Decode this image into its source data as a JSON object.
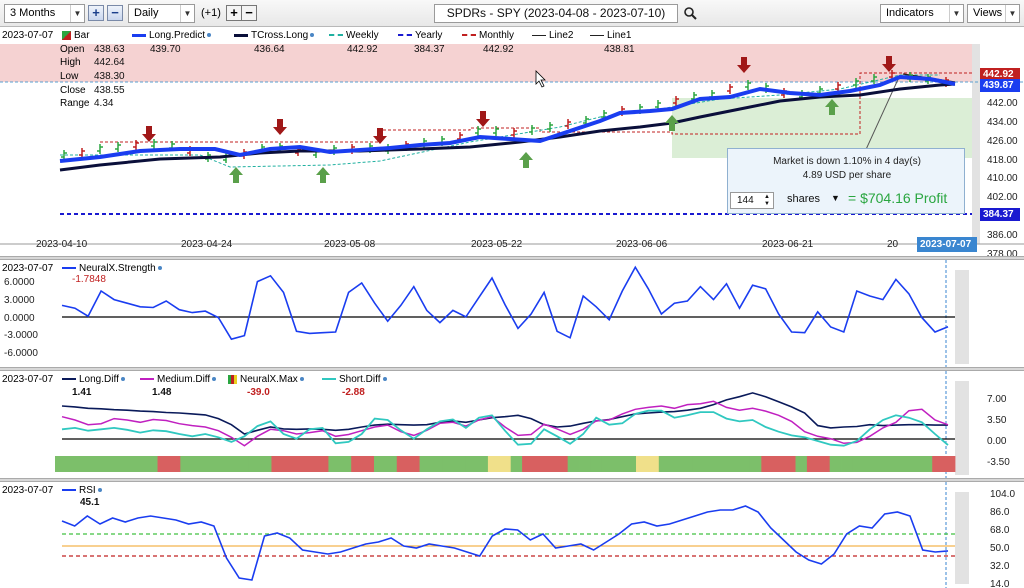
{
  "toolbar": {
    "range": "3 Months",
    "interval": "Daily",
    "offset": "(+1)",
    "title": "SPDRs - SPY (2023-04-08 - 2023-07-10)",
    "indicators": "Indicators",
    "views": "Views",
    "plus": "+",
    "minus": "−"
  },
  "main": {
    "date": "2023-07-07",
    "ohlc": {
      "open_label": "Open",
      "open": "438.63",
      "high_label": "High",
      "high": "442.64",
      "low_label": "Low",
      "low": "438.30",
      "close_label": "Close",
      "close": "438.55",
      "range_label": "Range",
      "range": "4.34"
    },
    "legend": {
      "bar": "Bar",
      "long_predict": "Long.Predict",
      "long_predict_val": "439.70",
      "tcross_long": "TCross.Long",
      "tcross_long_val": "436.64",
      "weekly": "Weekly",
      "weekly_val": "442.92",
      "yearly": "Yearly",
      "yearly_val": "384.37",
      "monthly": "Monthly",
      "monthly_val": "442.92",
      "line2": "Line2",
      "line1": "Line1",
      "line1_val": "438.81"
    },
    "y_ticks": [
      "450.00",
      "442.00",
      "434.00",
      "426.00",
      "418.00",
      "410.00",
      "402.00",
      "394.00",
      "386.00",
      "378.00"
    ],
    "x_ticks": [
      "2023-04-10",
      "2023-04-24",
      "2023-05-08",
      "2023-05-22",
      "2023-06-06",
      "2023-06-21",
      "20"
    ],
    "price_boxes": {
      "top": "442.92",
      "current": "439.87",
      "yearly": "384.37"
    },
    "cursor_date": "2023-07-07",
    "popup": {
      "line1": "Market is down 1.10% in 4 day(s)",
      "line2": "4.89 USD per share",
      "shares": "144",
      "shares_label": "shares",
      "profit": "= $704.16 Profit"
    }
  },
  "strength": {
    "date": "2023-07-07",
    "name": "NeuralX.Strength",
    "value": "-1.7848",
    "y_ticks": [
      "6.0000",
      "3.0000",
      "0.0000",
      "-3.0000",
      "-6.0000"
    ],
    "series": [
      1.2,
      0.8,
      -0.3,
      3.2,
      2.0,
      1.5,
      1.0,
      0.9,
      1.8,
      0.6,
      0.2,
      0.4,
      -0.5,
      -3.5,
      -3.0,
      4.5,
      5.3,
      3.0,
      -2.4,
      -2.7,
      -2.6,
      -2.5,
      3.0,
      4.3,
      1.5,
      -1.0,
      1.2,
      3.8,
      0.5,
      -1.2,
      0.5,
      -0.4,
      2.3,
      5.0,
      1.3,
      -2.0,
      0.0,
      3.0,
      -2.4,
      -3.3,
      2.5,
      1.0,
      -0.8,
      3.2,
      6.5,
      3.5,
      0.0,
      1.5,
      1.8,
      3.8,
      2.0,
      4.2,
      0.8,
      4.0,
      3.5,
      0.0,
      -2.5,
      -2.6,
      0.3,
      -1.8,
      -2.5,
      3.2,
      2.5,
      2.0,
      4.8,
      2.8,
      -0.5,
      -2.5,
      -1.78
    ]
  },
  "diffs": {
    "date": "2023-07-07",
    "long_name": "Long.Diff",
    "long_val": "1.41",
    "medium_name": "Medium.Diff",
    "medium_val": "1.48",
    "max_name": "NeuralX.Max",
    "max_val": "-39.0",
    "short_name": "Short.Diff",
    "short_val": "-2.88",
    "y_ticks": [
      "7.00",
      "3.50",
      "0.00",
      "-3.50"
    ],
    "long_series": [
      5.5,
      5.3,
      5.0,
      4.9,
      4.7,
      4.6,
      4.4,
      4.3,
      4.1,
      4.0,
      3.8,
      3.6,
      2.8,
      1.5,
      -0.5,
      0.3,
      1.0,
      0.6,
      0.5,
      0.6,
      0.5,
      0.3,
      0.5,
      1.0,
      1.4,
      1.6,
      1.5,
      1.4,
      1.5,
      2.0,
      2.3,
      2.0,
      2.5,
      3.0,
      3.2,
      3.5,
      2.8,
      1.5,
      1.0,
      1.2,
      1.8,
      2.3,
      2.6,
      3.2,
      3.8,
      4.0,
      4.2,
      4.3,
      4.6,
      5.0,
      5.8,
      6.8,
      7.5,
      8.3,
      7.5,
      6.4,
      5.3,
      4.0,
      1.3,
      0.8,
      1.0,
      1.1,
      1.5,
      1.3,
      1.4,
      1.5,
      1.5,
      1.4,
      1.41
    ],
    "medium_series": [
      3.2,
      2.5,
      1.5,
      1.7,
      2.8,
      2.5,
      2.0,
      2.6,
      2.4,
      1.7,
      1.3,
      1.0,
      0.2,
      -1.2,
      -3.0,
      -1.0,
      0.5,
      0.2,
      -0.5,
      -0.2,
      0.2,
      -1.0,
      -0.6,
      0.2,
      1.0,
      1.4,
      0.0,
      -0.8,
      0.3,
      1.8,
      2.0,
      1.2,
      2.5,
      3.2,
      1.0,
      -0.8,
      -0.6,
      1.6,
      0.6,
      -0.6,
      0.5,
      2.3,
      2.5,
      3.8,
      4.8,
      5.2,
      5.5,
      5.0,
      5.8,
      6.0,
      6.5,
      5.2,
      4.6,
      5.0,
      4.4,
      3.5,
      2.2,
      0.0,
      -1.0,
      -1.5,
      -2.5,
      -2.3,
      -1.0,
      0.8,
      2.0,
      4.5,
      4.8,
      2.5,
      1.48
    ],
    "short_series": [
      0.5,
      0.8,
      0.2,
      0.5,
      0.8,
      0.4,
      -0.2,
      0.3,
      0.1,
      -0.5,
      -1.0,
      -0.5,
      -1.2,
      -2.2,
      -1.0,
      1.2,
      2.2,
      -0.5,
      -1.5,
      0.5,
      0.8,
      -2.5,
      -2.2,
      -0.5,
      2.8,
      2.5,
      0.3,
      -1.5,
      0.5,
      2.2,
      2.6,
      0.8,
      3.0,
      3.5,
      0.2,
      -2.8,
      -2.6,
      0.5,
      -1.0,
      -2.6,
      -0.5,
      3.0,
      1.5,
      1.8,
      3.8,
      4.5,
      4.5,
      3.0,
      3.5,
      4.2,
      4.2,
      2.8,
      2.2,
      2.5,
      1.0,
      0.0,
      -0.8,
      -1.2,
      -2.0,
      -2.8,
      -3.0,
      -2.0,
      0.5,
      2.5,
      3.5,
      3.0,
      2.0,
      -0.5,
      -2.88
    ],
    "band": [
      "G",
      "G",
      "G",
      "G",
      "G",
      "G",
      "G",
      "G",
      "G",
      "R",
      "R",
      "G",
      "G",
      "G",
      "G",
      "G",
      "G",
      "G",
      "G",
      "R",
      "R",
      "R",
      "R",
      "R",
      "G",
      "G",
      "R",
      "R",
      "G",
      "G",
      "R",
      "R",
      "G",
      "G",
      "G",
      "G",
      "G",
      "G",
      "Y",
      "Y",
      "G",
      "R",
      "R",
      "R",
      "R",
      "G",
      "G",
      "G",
      "G",
      "G",
      "G",
      "Y",
      "Y",
      "G",
      "G",
      "G",
      "G",
      "G",
      "G",
      "G",
      "G",
      "G",
      "R",
      "R",
      "R",
      "G",
      "R",
      "R",
      "G",
      "G",
      "G",
      "G",
      "G",
      "G",
      "G",
      "G",
      "G",
      "R",
      "R"
    ]
  },
  "rsi": {
    "date": "2023-07-07",
    "name": "RSI",
    "value": "45.1",
    "y_ticks": [
      "104.0",
      "86.0",
      "68.0",
      "50.0",
      "32.0",
      "14.0"
    ],
    "series": [
      75,
      70,
      80,
      72,
      78,
      74,
      78,
      80,
      78,
      76,
      72,
      74,
      70,
      38,
      18,
      16,
      60,
      63,
      58,
      46,
      44,
      42,
      44,
      48,
      52,
      54,
      58,
      50,
      48,
      52,
      50,
      48,
      44,
      40,
      60,
      67,
      66,
      56,
      62,
      48,
      50,
      52,
      46,
      54,
      62,
      72,
      74,
      70,
      72,
      76,
      80,
      84,
      86,
      86,
      90,
      84,
      68,
      56,
      44,
      36,
      32,
      42,
      62,
      70,
      68,
      82,
      84,
      80,
      46,
      44,
      45.1
    ]
  }
}
